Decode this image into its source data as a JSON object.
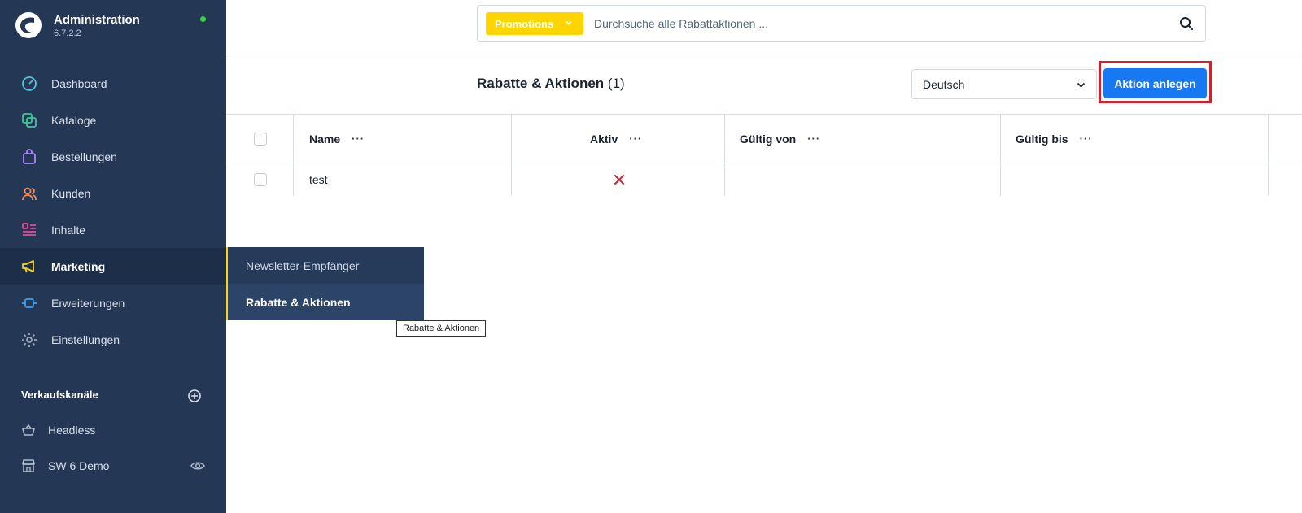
{
  "app": {
    "title": "Administration",
    "version": "6.7.2.2"
  },
  "nav": {
    "items": [
      {
        "label": "Dashboard",
        "icon": "dashboard-icon"
      },
      {
        "label": "Kataloge",
        "icon": "catalog-icon"
      },
      {
        "label": "Bestellungen",
        "icon": "orders-icon"
      },
      {
        "label": "Kunden",
        "icon": "customers-icon"
      },
      {
        "label": "Inhalte",
        "icon": "content-icon"
      },
      {
        "label": "Marketing",
        "icon": "marketing-icon"
      },
      {
        "label": "Erweiterungen",
        "icon": "extensions-icon"
      },
      {
        "label": "Einstellungen",
        "icon": "settings-icon"
      }
    ],
    "active": "Marketing"
  },
  "sales_channels": {
    "title": "Verkaufskanäle",
    "items": [
      {
        "label": "Headless",
        "icon": "basket-icon"
      },
      {
        "label": "SW 6 Demo",
        "icon": "storefront-icon"
      }
    ]
  },
  "flyout": {
    "items": [
      {
        "label": "Newsletter-Empfänger"
      },
      {
        "label": "Rabatte & Aktionen"
      }
    ],
    "tooltip": "Rabatte & Aktionen"
  },
  "search": {
    "type_label": "Promotions",
    "placeholder": "Durchsuche alle Rabattaktionen ..."
  },
  "header": {
    "title": "Rabatte & Aktionen",
    "count": "(1)",
    "language": "Deutsch",
    "create_button": "Aktion anlegen"
  },
  "table": {
    "columns": [
      "Name",
      "Aktiv",
      "Gültig von",
      "Gültig bis"
    ],
    "column_menu": "···",
    "rows": [
      {
        "name": "test",
        "active": false,
        "valid_from": "",
        "valid_to": ""
      }
    ]
  },
  "colors": {
    "sidebar": "#243754",
    "accent_yellow": "#ffd500",
    "primary": "#1877f2",
    "highlight": "#d2202c",
    "inactive_red": "#d2202c"
  }
}
